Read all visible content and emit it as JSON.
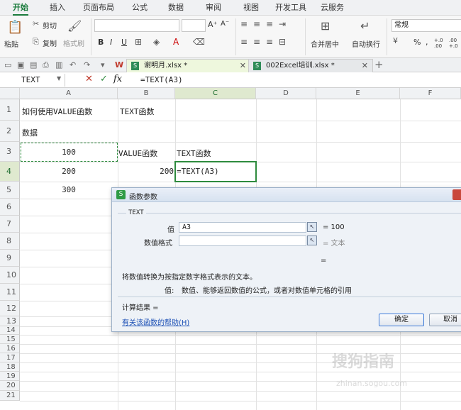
{
  "menu": {
    "tabs": [
      "开始",
      "插入",
      "页面布局",
      "公式",
      "数据",
      "审阅",
      "视图",
      "开发工具",
      "云服务"
    ]
  },
  "ribbon": {
    "paste": "粘贴",
    "cut": "剪切",
    "copy": "复制",
    "format_painter": "格式刷",
    "bold": "B",
    "italic": "I",
    "underline": "U",
    "font_size_up": "A⁺",
    "font_size_down": "A⁻",
    "merge_center": "合并居中",
    "wrap_text": "自动换行",
    "number_format": "常规",
    "percent": "%",
    "comma": ",",
    "inc_decimal": "+.0 .00",
    "dec_decimal": ".00 +.0"
  },
  "tabs": {
    "doc1": "谢明月.xlsx *",
    "doc2": "002Excel培训.xlsx *",
    "new_tab": "+"
  },
  "formula_bar": {
    "name_box": "TEXT",
    "cancel": "✕",
    "confirm": "✓",
    "fx": "fx",
    "formula": "=TEXT(A3)"
  },
  "sheet": {
    "columns": [
      "A",
      "B",
      "C",
      "D",
      "E",
      "F"
    ],
    "rows": [
      "1",
      "2",
      "3",
      "4",
      "5",
      "6",
      "7",
      "8",
      "9",
      "10",
      "11",
      "12",
      "13",
      "14",
      "15",
      "16",
      "17",
      "18",
      "19",
      "20",
      "21"
    ],
    "cells": {
      "A1": "如何使用VALUE函数",
      "B1": "TEXT函数",
      "A2": "数据",
      "A3": "100",
      "B3": "VALUE函数",
      "C3": "TEXT函数",
      "A4": "200",
      "B4": "200",
      "C4": "=TEXT(A3)",
      "A5": "300"
    }
  },
  "dialog": {
    "title": "函数参数",
    "function_name": "TEXT",
    "arg1_label": "值",
    "arg1_value": "A3",
    "arg1_result": "= 100",
    "arg2_label": "数值格式",
    "arg2_value": "",
    "arg2_result": "= 文本",
    "overall_eq": "=",
    "description": "将数值转换为按指定数字格式表示的文本。",
    "param_desc_label": "值:",
    "param_desc": "数值、能够返回数值的公式，或者对数值单元格的引用",
    "calc_result_label": "计算结果 =",
    "help_link": "有关该函数的帮助(H)",
    "ok": "确定",
    "cancel": "取消"
  },
  "watermark": {
    "main": "搜狗指南",
    "sub": "zhinan.sogou.com"
  },
  "colors": {
    "accent_green": "#1a7b3c",
    "selection_green": "#2e8b3e",
    "link_blue": "#1a4fb5"
  }
}
